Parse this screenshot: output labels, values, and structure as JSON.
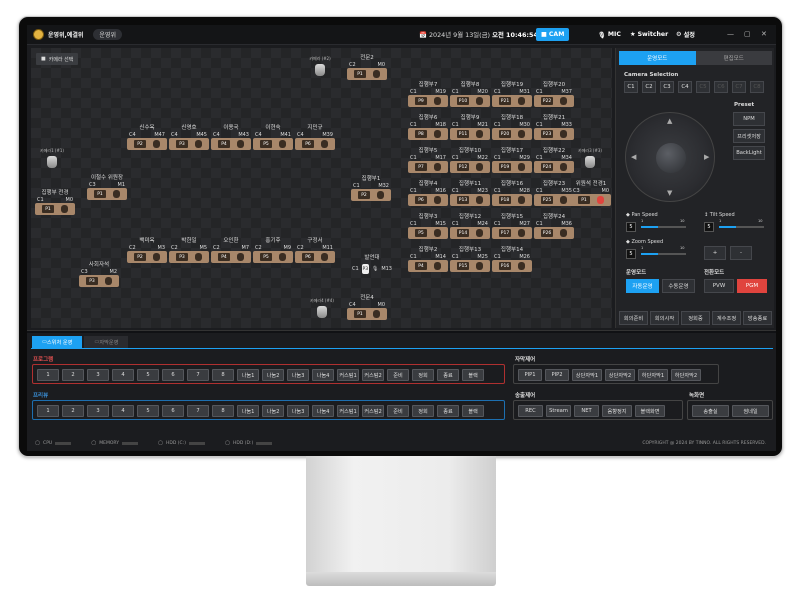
{
  "app": {
    "name": "운영위,예결위",
    "mode_pill": "운영위",
    "datetime_prefix": "📅 2024년 9월 13일(금)",
    "datetime_time": "오전 10:46:54",
    "top_buttons": [
      "CAM",
      "MIC",
      "Switcher",
      "설정"
    ],
    "window_controls": [
      "—",
      "▢",
      "✕"
    ]
  },
  "stage": {
    "camera_select": "카메라 선택",
    "cameras": [
      {
        "label": "카메라 (#2)"
      },
      {
        "label": "카메라1 (#1)"
      },
      {
        "label": "카메라3 (#3)"
      },
      {
        "label": "카메라4 (#4)"
      }
    ],
    "seats": [
      {
        "name": "전문2",
        "c": "C2",
        "m": "M0",
        "p": "P1"
      },
      {
        "name": "신수옥",
        "c": "C4",
        "m": "M47",
        "p": "P2"
      },
      {
        "name": "신영호",
        "c": "C4",
        "m": "M45",
        "p": "P3"
      },
      {
        "name": "이용국",
        "c": "C4",
        "m": "M43",
        "p": "P4"
      },
      {
        "name": "이현숙",
        "c": "C4",
        "m": "M41",
        "p": "P5"
      },
      {
        "name": "지민규",
        "c": "C4",
        "m": "M39",
        "p": "P6"
      },
      {
        "name": "이철수 위원장",
        "c": "C3",
        "m": "M1",
        "p": "P1"
      },
      {
        "name": "집행부 전경",
        "c": "C1",
        "m": "M0",
        "p": "P1"
      },
      {
        "name": "백미옥",
        "c": "C2",
        "m": "M3",
        "p": "P2"
      },
      {
        "name": "박한일",
        "c": "C2",
        "m": "M5",
        "p": "P3"
      },
      {
        "name": "오인환",
        "c": "C2",
        "m": "M7",
        "p": "P4"
      },
      {
        "name": "홍기후",
        "c": "C2",
        "m": "M9",
        "p": "P5"
      },
      {
        "name": "구정서",
        "c": "C2",
        "m": "M11",
        "p": "P6"
      },
      {
        "name": "사회자석",
        "c": "C3",
        "m": "M2",
        "p": "P3"
      },
      {
        "name": "전문4",
        "c": "C4",
        "m": "M0",
        "p": "P1"
      },
      {
        "name": "집행부1",
        "c": "C1",
        "m": "M32",
        "p": "P2"
      },
      {
        "name": "집행부7",
        "c": "C1",
        "m": "M19",
        "p": "P9"
      },
      {
        "name": "집행부8",
        "c": "C1",
        "m": "M20",
        "p": "P10"
      },
      {
        "name": "집행부19",
        "c": "C1",
        "m": "M31",
        "p": "P21"
      },
      {
        "name": "집행부20",
        "c": "C1",
        "m": "M37",
        "p": "P22"
      },
      {
        "name": "집행부6",
        "c": "C1",
        "m": "M18",
        "p": "P8"
      },
      {
        "name": "집행부9",
        "c": "C1",
        "m": "M21",
        "p": "P11"
      },
      {
        "name": "집행부18",
        "c": "C1",
        "m": "M30",
        "p": "P20"
      },
      {
        "name": "집행부21",
        "c": "C1",
        "m": "M33",
        "p": "P23"
      },
      {
        "name": "집행부5",
        "c": "C1",
        "m": "M17",
        "p": "P7"
      },
      {
        "name": "집행부10",
        "c": "C1",
        "m": "M22",
        "p": "P12"
      },
      {
        "name": "집행부17",
        "c": "C1",
        "m": "M29",
        "p": "P19"
      },
      {
        "name": "집행부22",
        "c": "C1",
        "m": "M34",
        "p": "P24"
      },
      {
        "name": "집행부4",
        "c": "C1",
        "m": "M16",
        "p": "P6"
      },
      {
        "name": "집행부11",
        "c": "C1",
        "m": "M23",
        "p": "P13"
      },
      {
        "name": "집행부16",
        "c": "C1",
        "m": "M28",
        "p": "P18"
      },
      {
        "name": "집행부23",
        "c": "C1",
        "m": "M35",
        "p": "P25"
      },
      {
        "name": "위원석 전경1",
        "c": "C3",
        "m": "M0",
        "p": "P1"
      },
      {
        "name": "집행부3",
        "c": "C1",
        "m": "M15",
        "p": "P5"
      },
      {
        "name": "집행부12",
        "c": "C1",
        "m": "M24",
        "p": "P14"
      },
      {
        "name": "집행부15",
        "c": "C1",
        "m": "M27",
        "p": "P17"
      },
      {
        "name": "집행부24",
        "c": "C1",
        "m": "M36",
        "p": "P26"
      },
      {
        "name": "집행부2",
        "c": "C1",
        "m": "M14",
        "p": "P4"
      },
      {
        "name": "집행부13",
        "c": "C1",
        "m": "M25",
        "p": "P15"
      },
      {
        "name": "집행부14",
        "c": "C1",
        "m": "M26",
        "p": "P16"
      }
    ],
    "speaker": {
      "name": "발언대",
      "c": "C1",
      "m": "M13",
      "p": "P3"
    }
  },
  "right": {
    "tabs": [
      "운영모드",
      "편집모드"
    ],
    "camera_selection": "Camera Selection",
    "cam_buttons": [
      "C1",
      "C2",
      "C3",
      "C4",
      "C5",
      "C6",
      "C7",
      "C8"
    ],
    "preset_label": "Preset",
    "presets": [
      "NPM",
      "프리셋저장",
      "BackLight"
    ],
    "pan_label": "Pan Speed",
    "tilt_label": "Tilt Speed",
    "zoom_label": "Zoom Speed",
    "pan_val": "5",
    "tilt_val": "5",
    "zoom_val": "5",
    "pan_min": "1",
    "pan_max": "10",
    "tilt_min": "1",
    "tilt_max": "10",
    "zoom_min": "1",
    "zoom_max": "10",
    "plus": "+",
    "minus": "-",
    "op_mode_label": "운영모드",
    "op_modes": [
      "자동운영",
      "수동운영"
    ],
    "switch_mode_label": "전환모드",
    "switch_modes": [
      "PVW",
      "PGM"
    ],
    "bottom": [
      "회의준비",
      "회의시작",
      "정회중",
      "계수조정",
      "방송종료"
    ]
  },
  "bottom": {
    "tabs": [
      "스위처 운영",
      "자막운영"
    ],
    "program_label": "프로그램",
    "preview_label": "프리뷰",
    "keys": [
      "1",
      "2",
      "3",
      "4",
      "5",
      "6",
      "7",
      "8",
      "나눔1",
      "나눔2",
      "나눔3",
      "나눔4",
      "커스텀1",
      "커스텀2",
      "준비",
      "정회",
      "종료",
      "블랙"
    ],
    "caption_label": "자막제어",
    "caption_keys": [
      "PIP1",
      "PIP2",
      "상단자막1",
      "상단자막2",
      "하단자막1",
      "하단자막2"
    ],
    "broadcast_label": "송출제어",
    "broadcast_keys": [
      "REC",
      "Stream",
      "NET",
      "음향정지",
      "블랙화면"
    ],
    "record_label": "녹화면",
    "record_keys": [
      "송출실",
      "썸네일"
    ]
  },
  "status": {
    "items": [
      "CPU",
      "MEMORY",
      "HDD (C:)",
      "HDD (D:)"
    ],
    "copyright": "COPYRIGHT @ 2024 BY TINNO. ALL RIGHTS RESERVED."
  },
  "colors": {
    "accent": "#1da1f2",
    "pgm": "#e0443e",
    "program_border": "#b03030",
    "preview_border": "#1d6fb0"
  }
}
